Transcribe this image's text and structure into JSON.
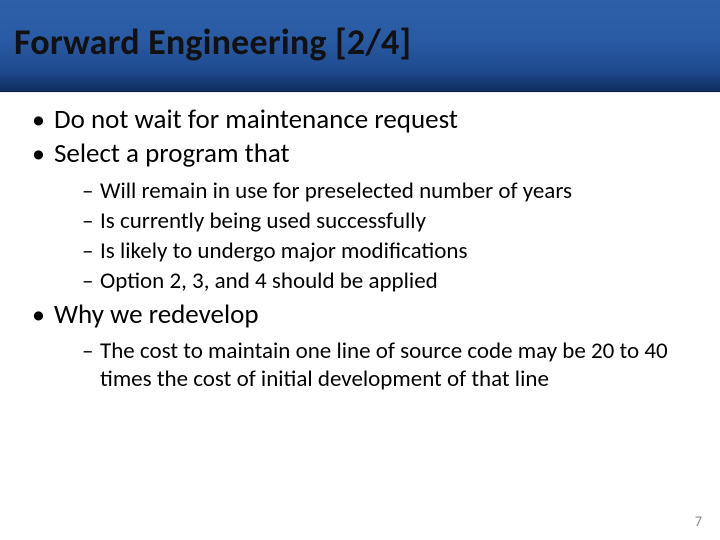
{
  "title": "Forward Engineering [2/4]",
  "bullets": {
    "b1": "Do not wait for maintenance request",
    "b2": "Select a program that",
    "b2_sub": {
      "s1": "Will remain in use for preselected number of years",
      "s2": "Is currently being used successfully",
      "s3": "Is likely to undergo major modifications",
      "s4": "Option 2, 3, and 4 should be applied"
    },
    "b3": "Why we redevelop",
    "b3_sub": {
      "s1": " The cost to maintain one line of source code may be 20 to 40 times the cost of initial development of that line"
    }
  },
  "page_number": "7"
}
